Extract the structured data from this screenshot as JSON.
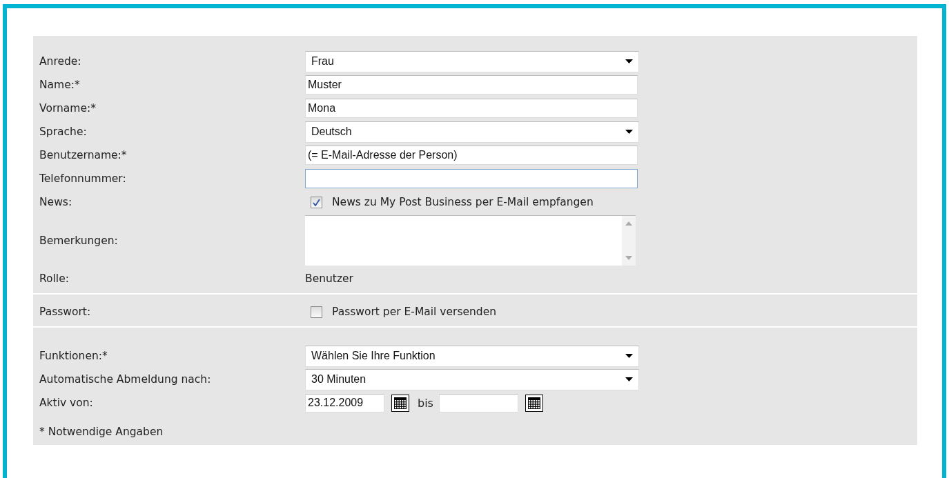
{
  "sections": [
    {
      "rows": [
        {
          "kind": "select",
          "label": "Anrede:",
          "value": "Frau"
        },
        {
          "kind": "text",
          "label": "Name:*",
          "value": "Muster"
        },
        {
          "kind": "text",
          "label": "Vorname:*",
          "value": "Mona"
        },
        {
          "kind": "select",
          "label": "Sprache:",
          "value": "Deutsch"
        },
        {
          "kind": "text",
          "label": "Benutzername:*",
          "value": "(= E-Mail-Adresse der Person)"
        },
        {
          "kind": "text",
          "label": "Telefonnummer:",
          "value": "",
          "focused": true
        },
        {
          "kind": "checkbox",
          "label": "News:",
          "text": "News zu My Post Business per E-Mail empfangen",
          "checked": true
        },
        {
          "kind": "textarea",
          "label": "Bemerkungen:"
        },
        {
          "kind": "static",
          "label": "Rolle:",
          "value": "Benutzer"
        }
      ]
    },
    {
      "rows": [
        {
          "kind": "checkbox",
          "label": "Passwort:",
          "text": "Passwort per E-Mail versenden",
          "checked": false
        }
      ]
    },
    {
      "rows": [
        {
          "kind": "select",
          "label": "Funktionen:*",
          "value": "Wählen Sie Ihre Funktion"
        },
        {
          "kind": "select",
          "label": "Automatische Abmeldung nach:",
          "value": "30 Minuten"
        },
        {
          "kind": "daterange",
          "label": "Aktiv von:",
          "from": "23.12.2009",
          "separator": "bis",
          "to": ""
        }
      ],
      "note": "* Notwendige Angaben"
    }
  ]
}
